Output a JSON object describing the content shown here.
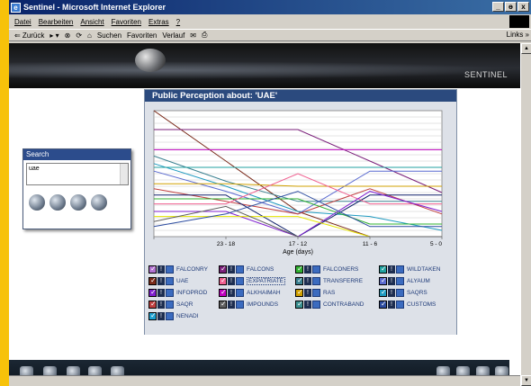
{
  "window": {
    "title": "Sentinel - Microsoft Internet Explorer",
    "buttons": [
      "_",
      "ɵ",
      "x"
    ]
  },
  "menu": [
    "Datei",
    "Bearbeiten",
    "Ansicht",
    "Favoriten",
    "Extras",
    "?"
  ],
  "toolbar": {
    "back": "⇐ Zurück",
    "search": "Suchen",
    "favorites": "Favoriten",
    "history": "Verlauf",
    "links": "Links »"
  },
  "banner": {
    "brand": "SENTINEL"
  },
  "search_box": {
    "title": "Search",
    "value": "uae"
  },
  "panel": {
    "title": "Public Perception about: 'UAE'"
  },
  "chart_data": {
    "type": "line",
    "xlabel": "Age (days)",
    "x": [
      0,
      1,
      2,
      3,
      4
    ],
    "x_tick_labels": [
      "",
      "23 - 18",
      "17 - 12",
      "11 - 6",
      "5 - 0"
    ],
    "ylim": [
      0,
      100
    ],
    "series": [
      {
        "color": "#7a2a1a",
        "values": [
          100,
          60,
          20,
          0,
          0
        ]
      },
      {
        "color": "#7a1f7a",
        "values": [
          85,
          85,
          85,
          60,
          35
        ]
      },
      {
        "color": "#c000c0",
        "values": [
          69,
          69,
          69,
          69,
          69
        ]
      },
      {
        "color": "#3a8090",
        "values": [
          64,
          44,
          28,
          28,
          28
        ]
      },
      {
        "color": "#1f9ac0",
        "values": [
          58,
          40,
          20,
          16,
          5
        ]
      },
      {
        "color": "#20a0a0",
        "values": [
          55,
          55,
          55,
          55,
          55
        ]
      },
      {
        "color": "#5a6ad0",
        "values": [
          52,
          36,
          18,
          52,
          52
        ]
      },
      {
        "color": "#d0a000",
        "values": [
          42,
          42,
          40,
          40,
          40
        ]
      },
      {
        "color": "#c04040",
        "values": [
          38,
          28,
          18,
          38,
          18
        ]
      },
      {
        "color": "#10206a",
        "values": [
          33,
          33,
          0,
          33,
          33
        ]
      },
      {
        "color": "#30b030",
        "values": [
          30,
          30,
          30,
          10,
          10
        ]
      },
      {
        "color": "#f06090",
        "values": [
          26,
          26,
          50,
          26,
          26
        ]
      },
      {
        "color": "#8020d0",
        "values": [
          20,
          20,
          0,
          36,
          20
        ]
      },
      {
        "color": "#e6e600",
        "values": [
          16,
          16,
          16,
          0,
          0
        ]
      },
      {
        "color": "#606060",
        "values": [
          12,
          24,
          0,
          0,
          0
        ]
      },
      {
        "color": "#2c4ca0",
        "values": [
          8,
          18,
          36,
          8,
          8
        ]
      }
    ]
  },
  "legend": {
    "items": [
      {
        "label": "FALCONRY",
        "color": "#b070d0"
      },
      {
        "label": "FALCONS",
        "color": "#7a1f7a"
      },
      {
        "label": "FALCONERS",
        "color": "#30b030"
      },
      {
        "label": "WILDTAKEN",
        "color": "#20a0a0"
      },
      {
        "label": "UAE",
        "color": "#7a2a1a"
      },
      {
        "label": "EXPATRIATE",
        "color": "#f06090"
      },
      {
        "label": "TRANSFERRE",
        "color": "#3a8090"
      },
      {
        "label": "ALYAUM",
        "color": "#5a6ad0"
      },
      {
        "label": "INFOPROD",
        "color": "#8020d0"
      },
      {
        "label": "ALKHAIMAH",
        "color": "#c000c0"
      },
      {
        "label": "RAS",
        "color": "#d0a000"
      },
      {
        "label": "SAQRS",
        "color": "#1f9ac0"
      },
      {
        "label": "SAQR",
        "color": "#c04040"
      },
      {
        "label": "IMPOUNDS",
        "color": "#606060"
      },
      {
        "label": "CONTRABAND",
        "color": "#3a9090"
      },
      {
        "label": "CUSTOMS",
        "color": "#2c4ca0"
      },
      {
        "label": "NENADI",
        "color": "#1fa0d0"
      }
    ]
  }
}
